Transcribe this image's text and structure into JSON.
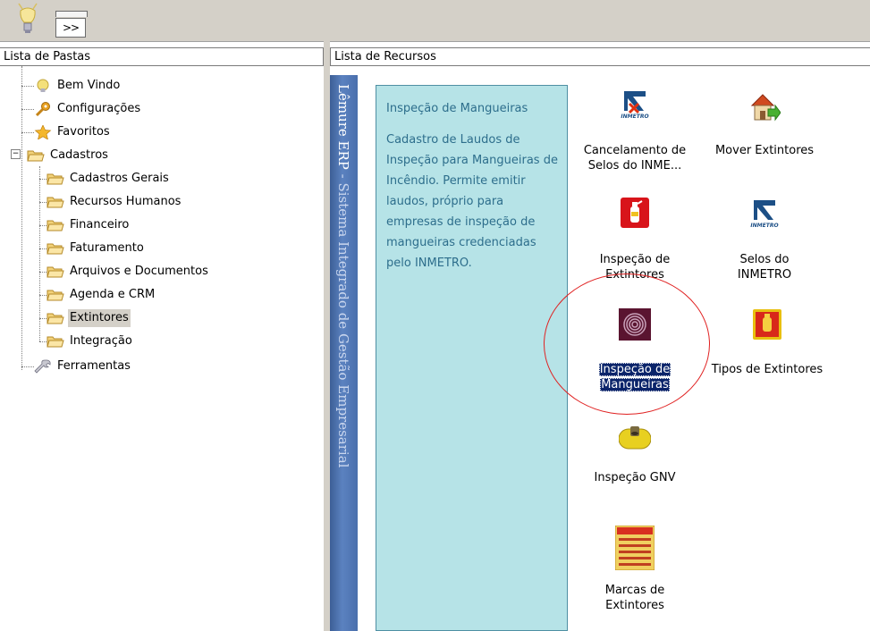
{
  "toolbar": {
    "bulb_icon": "lightbulb-icon",
    "expand_label": ">>"
  },
  "left_pane": {
    "header": "Lista de Pastas",
    "items": [
      {
        "label": "Bem Vindo",
        "icon": "lightbulb-icon"
      },
      {
        "label": "Configurações",
        "icon": "key-icon"
      },
      {
        "label": "Favoritos",
        "icon": "star-icon"
      },
      {
        "label": "Cadastros",
        "icon": "folder-open-icon",
        "expanded": true
      },
      {
        "label": "Cadastros Gerais",
        "icon": "folder-icon"
      },
      {
        "label": "Recursos Humanos",
        "icon": "folder-icon"
      },
      {
        "label": "Financeiro",
        "icon": "folder-icon"
      },
      {
        "label": "Faturamento",
        "icon": "folder-icon"
      },
      {
        "label": "Arquivos e Documentos",
        "icon": "folder-icon"
      },
      {
        "label": "Agenda e CRM",
        "icon": "folder-icon"
      },
      {
        "label": "Extintores",
        "icon": "folder-icon",
        "selected": true
      },
      {
        "label": "Integração",
        "icon": "folder-icon"
      },
      {
        "label": "Ferramentas",
        "icon": "wrench-icon"
      }
    ]
  },
  "right_pane": {
    "header": "Lista de Recursos",
    "vertical_banner_brand": "Lêmure ERP",
    "vertical_banner_rest": " - Sistema Integrado de Gestão Empresarial",
    "description": {
      "title": "Inspeção de Mangueiras",
      "text": "Cadastro de Laudos de Inspeção para Mangueiras de Incêndio. Permite emitir laudos, próprio para empresas de inspeção de mangueiras credenciadas pelo INMETRO."
    },
    "resources": [
      {
        "label_line1": "Cancelamento de",
        "label_line2": "Selos do INME...",
        "icon": "inmetro-cancel-icon"
      },
      {
        "label_line1": "Mover Extintores",
        "label_line2": "",
        "icon": "house-arrow-icon"
      },
      {
        "label_line1": "Inspeção de",
        "label_line2": "Extintores",
        "icon": "fire-extinguisher-icon"
      },
      {
        "label_line1": "Selos do",
        "label_line2": "INMETRO",
        "icon": "inmetro-seal-icon"
      },
      {
        "label_line1": "Inspeção de",
        "label_line2": "Mangueiras",
        "icon": "hose-reel-icon",
        "selected": true
      },
      {
        "label_line1": "Tipos de Extintores",
        "label_line2": "",
        "icon": "extinguisher-types-icon"
      },
      {
        "label_line1": "Inspeção GNV",
        "label_line2": "",
        "icon": "gnv-cylinder-icon"
      },
      {
        "label_line1": "Marcas de",
        "label_line2": "Extintores",
        "icon": "extinguisher-label-icon"
      }
    ]
  },
  "colors": {
    "description_bg": "#b6e3e7",
    "description_text": "#2d6e8c",
    "selection_bg": "#0a246a",
    "annotation_circle": "#e02020"
  }
}
